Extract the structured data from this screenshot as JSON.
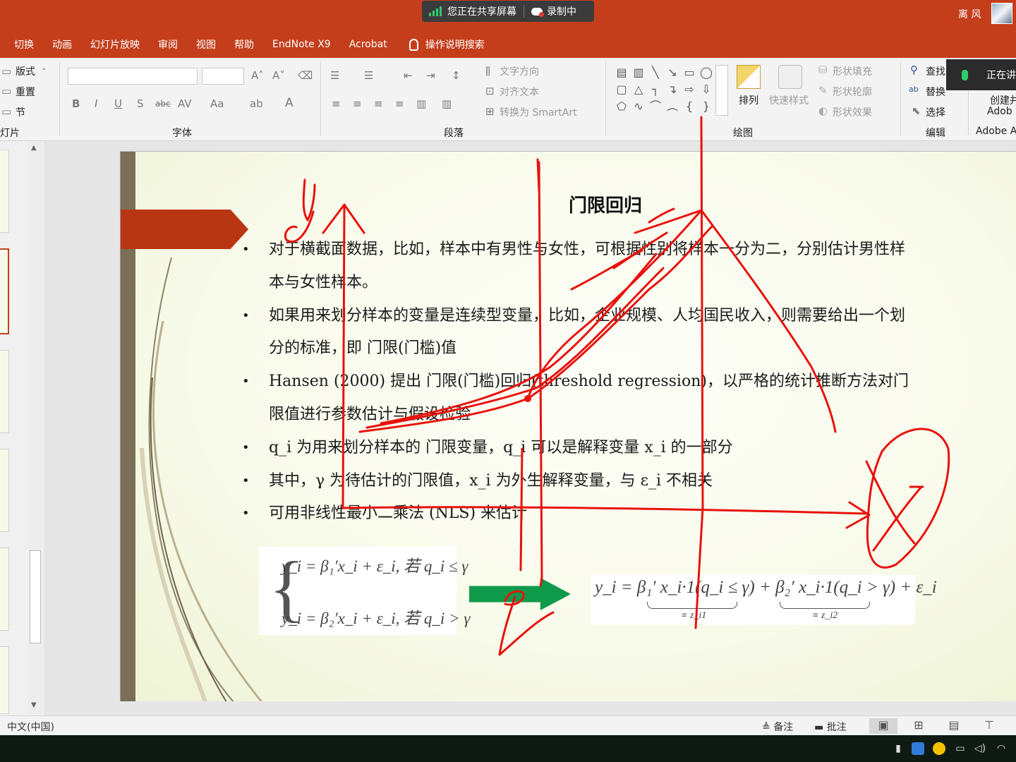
{
  "titlebar": {
    "share_status": "您正在共享屏幕",
    "recording_status": "录制中",
    "user_name": "离 风"
  },
  "menu": {
    "items": [
      "切换",
      "动画",
      "幻灯片放映",
      "审阅",
      "视图",
      "帮助",
      "EndNote X9",
      "Acrobat"
    ],
    "tell_me": "操作说明搜索"
  },
  "ribbon": {
    "slides_group": {
      "layout": "版式",
      "reset": "重置",
      "section": "节",
      "label": "灯片"
    },
    "font_group": {
      "label": "字体"
    },
    "paragraph_group": {
      "text_direction": "文字方向",
      "align_text": "对齐文本",
      "convert_smartart": "转换为 SmartArt",
      "label": "段落"
    },
    "drawing_group": {
      "arrange": "排列",
      "quick_styles": "快速样式",
      "shape_fill": "形状填充",
      "shape_outline": "形状轮廓",
      "shape_effects": "形状效果",
      "label": "绘图"
    },
    "editing_group": {
      "find": "查找",
      "replace": "替换",
      "select": "选择",
      "label": "编辑"
    },
    "adobe_group": {
      "create": "创建并",
      "adobe": "Adob",
      "label": "Adobe A"
    },
    "mic_popup": "正在讲"
  },
  "slide": {
    "title": "门限回归",
    "bullets": [
      "对于横截面数据，比如，样本中有男性与女性，可根据性别将样本一分为二，分别估计男性样本与女性样本。",
      "如果用来划分样本的变量是连续型变量，比如，企业规模、人均国民收入，则需要给出一个划分的标准，即 门限(门槛)值",
      "Hansen (2000) 提出 门限(门槛)回归(threshold regression)，以严格的统计推断方法对门限值进行参数估计与假设检验",
      "q_i 为用来划分样本的 门限变量，q_i 可以是解释变量 x_i 的一部分",
      "其中，γ 为待估计的门限值，x_i 为外生解释变量，与 ε_i 不相关",
      "可用非线性最小二乘法 (NLS) 来估计"
    ],
    "equation_left_1": "y_i = β₁′x_i + ε_i, 若 q_i ≤ γ",
    "equation_left_2": "y_i = β₂′x_i + ε_i, 若 q_i > γ",
    "equation_right": "y_i = β₁′ x_i·1(q_i ≤ γ) + β₂′ x_i·1(q_i > γ) + ε_i",
    "underbrace_1": "≡ z_i1",
    "underbrace_2": "≡ z_i2"
  },
  "statusbar": {
    "language": "中文(中国)",
    "notes": "备注",
    "comments": "批注"
  },
  "colors": {
    "accent": "#c43e1c",
    "ink": "#e8120c",
    "slide_arrow": "#b83612",
    "green_arrow": "#0e9a4a",
    "recording_green": "#2ecc71"
  }
}
